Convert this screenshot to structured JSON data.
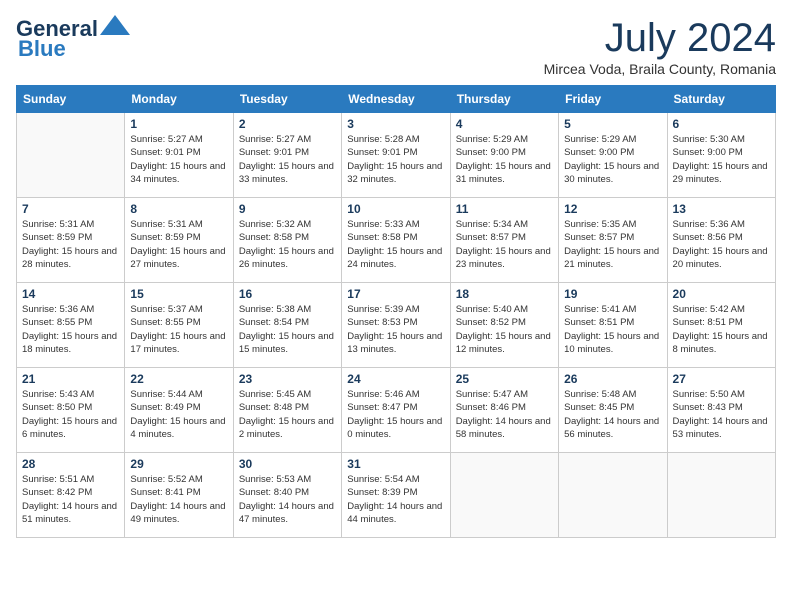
{
  "logo": {
    "line1": "General",
    "line2": "Blue"
  },
  "title": "July 2024",
  "location": "Mircea Voda, Braila County, Romania",
  "days_of_week": [
    "Sunday",
    "Monday",
    "Tuesday",
    "Wednesday",
    "Thursday",
    "Friday",
    "Saturday"
  ],
  "weeks": [
    [
      {
        "day": "",
        "sunrise": "",
        "sunset": "",
        "daylight": ""
      },
      {
        "day": "1",
        "sunrise": "Sunrise: 5:27 AM",
        "sunset": "Sunset: 9:01 PM",
        "daylight": "Daylight: 15 hours and 34 minutes."
      },
      {
        "day": "2",
        "sunrise": "Sunrise: 5:27 AM",
        "sunset": "Sunset: 9:01 PM",
        "daylight": "Daylight: 15 hours and 33 minutes."
      },
      {
        "day": "3",
        "sunrise": "Sunrise: 5:28 AM",
        "sunset": "Sunset: 9:01 PM",
        "daylight": "Daylight: 15 hours and 32 minutes."
      },
      {
        "day": "4",
        "sunrise": "Sunrise: 5:29 AM",
        "sunset": "Sunset: 9:00 PM",
        "daylight": "Daylight: 15 hours and 31 minutes."
      },
      {
        "day": "5",
        "sunrise": "Sunrise: 5:29 AM",
        "sunset": "Sunset: 9:00 PM",
        "daylight": "Daylight: 15 hours and 30 minutes."
      },
      {
        "day": "6",
        "sunrise": "Sunrise: 5:30 AM",
        "sunset": "Sunset: 9:00 PM",
        "daylight": "Daylight: 15 hours and 29 minutes."
      }
    ],
    [
      {
        "day": "7",
        "sunrise": "Sunrise: 5:31 AM",
        "sunset": "Sunset: 8:59 PM",
        "daylight": "Daylight: 15 hours and 28 minutes."
      },
      {
        "day": "8",
        "sunrise": "Sunrise: 5:31 AM",
        "sunset": "Sunset: 8:59 PM",
        "daylight": "Daylight: 15 hours and 27 minutes."
      },
      {
        "day": "9",
        "sunrise": "Sunrise: 5:32 AM",
        "sunset": "Sunset: 8:58 PM",
        "daylight": "Daylight: 15 hours and 26 minutes."
      },
      {
        "day": "10",
        "sunrise": "Sunrise: 5:33 AM",
        "sunset": "Sunset: 8:58 PM",
        "daylight": "Daylight: 15 hours and 24 minutes."
      },
      {
        "day": "11",
        "sunrise": "Sunrise: 5:34 AM",
        "sunset": "Sunset: 8:57 PM",
        "daylight": "Daylight: 15 hours and 23 minutes."
      },
      {
        "day": "12",
        "sunrise": "Sunrise: 5:35 AM",
        "sunset": "Sunset: 8:57 PM",
        "daylight": "Daylight: 15 hours and 21 minutes."
      },
      {
        "day": "13",
        "sunrise": "Sunrise: 5:36 AM",
        "sunset": "Sunset: 8:56 PM",
        "daylight": "Daylight: 15 hours and 20 minutes."
      }
    ],
    [
      {
        "day": "14",
        "sunrise": "Sunrise: 5:36 AM",
        "sunset": "Sunset: 8:55 PM",
        "daylight": "Daylight: 15 hours and 18 minutes."
      },
      {
        "day": "15",
        "sunrise": "Sunrise: 5:37 AM",
        "sunset": "Sunset: 8:55 PM",
        "daylight": "Daylight: 15 hours and 17 minutes."
      },
      {
        "day": "16",
        "sunrise": "Sunrise: 5:38 AM",
        "sunset": "Sunset: 8:54 PM",
        "daylight": "Daylight: 15 hours and 15 minutes."
      },
      {
        "day": "17",
        "sunrise": "Sunrise: 5:39 AM",
        "sunset": "Sunset: 8:53 PM",
        "daylight": "Daylight: 15 hours and 13 minutes."
      },
      {
        "day": "18",
        "sunrise": "Sunrise: 5:40 AM",
        "sunset": "Sunset: 8:52 PM",
        "daylight": "Daylight: 15 hours and 12 minutes."
      },
      {
        "day": "19",
        "sunrise": "Sunrise: 5:41 AM",
        "sunset": "Sunset: 8:51 PM",
        "daylight": "Daylight: 15 hours and 10 minutes."
      },
      {
        "day": "20",
        "sunrise": "Sunrise: 5:42 AM",
        "sunset": "Sunset: 8:51 PM",
        "daylight": "Daylight: 15 hours and 8 minutes."
      }
    ],
    [
      {
        "day": "21",
        "sunrise": "Sunrise: 5:43 AM",
        "sunset": "Sunset: 8:50 PM",
        "daylight": "Daylight: 15 hours and 6 minutes."
      },
      {
        "day": "22",
        "sunrise": "Sunrise: 5:44 AM",
        "sunset": "Sunset: 8:49 PM",
        "daylight": "Daylight: 15 hours and 4 minutes."
      },
      {
        "day": "23",
        "sunrise": "Sunrise: 5:45 AM",
        "sunset": "Sunset: 8:48 PM",
        "daylight": "Daylight: 15 hours and 2 minutes."
      },
      {
        "day": "24",
        "sunrise": "Sunrise: 5:46 AM",
        "sunset": "Sunset: 8:47 PM",
        "daylight": "Daylight: 15 hours and 0 minutes."
      },
      {
        "day": "25",
        "sunrise": "Sunrise: 5:47 AM",
        "sunset": "Sunset: 8:46 PM",
        "daylight": "Daylight: 14 hours and 58 minutes."
      },
      {
        "day": "26",
        "sunrise": "Sunrise: 5:48 AM",
        "sunset": "Sunset: 8:45 PM",
        "daylight": "Daylight: 14 hours and 56 minutes."
      },
      {
        "day": "27",
        "sunrise": "Sunrise: 5:50 AM",
        "sunset": "Sunset: 8:43 PM",
        "daylight": "Daylight: 14 hours and 53 minutes."
      }
    ],
    [
      {
        "day": "28",
        "sunrise": "Sunrise: 5:51 AM",
        "sunset": "Sunset: 8:42 PM",
        "daylight": "Daylight: 14 hours and 51 minutes."
      },
      {
        "day": "29",
        "sunrise": "Sunrise: 5:52 AM",
        "sunset": "Sunset: 8:41 PM",
        "daylight": "Daylight: 14 hours and 49 minutes."
      },
      {
        "day": "30",
        "sunrise": "Sunrise: 5:53 AM",
        "sunset": "Sunset: 8:40 PM",
        "daylight": "Daylight: 14 hours and 47 minutes."
      },
      {
        "day": "31",
        "sunrise": "Sunrise: 5:54 AM",
        "sunset": "Sunset: 8:39 PM",
        "daylight": "Daylight: 14 hours and 44 minutes."
      },
      {
        "day": "",
        "sunrise": "",
        "sunset": "",
        "daylight": ""
      },
      {
        "day": "",
        "sunrise": "",
        "sunset": "",
        "daylight": ""
      },
      {
        "day": "",
        "sunrise": "",
        "sunset": "",
        "daylight": ""
      }
    ]
  ]
}
